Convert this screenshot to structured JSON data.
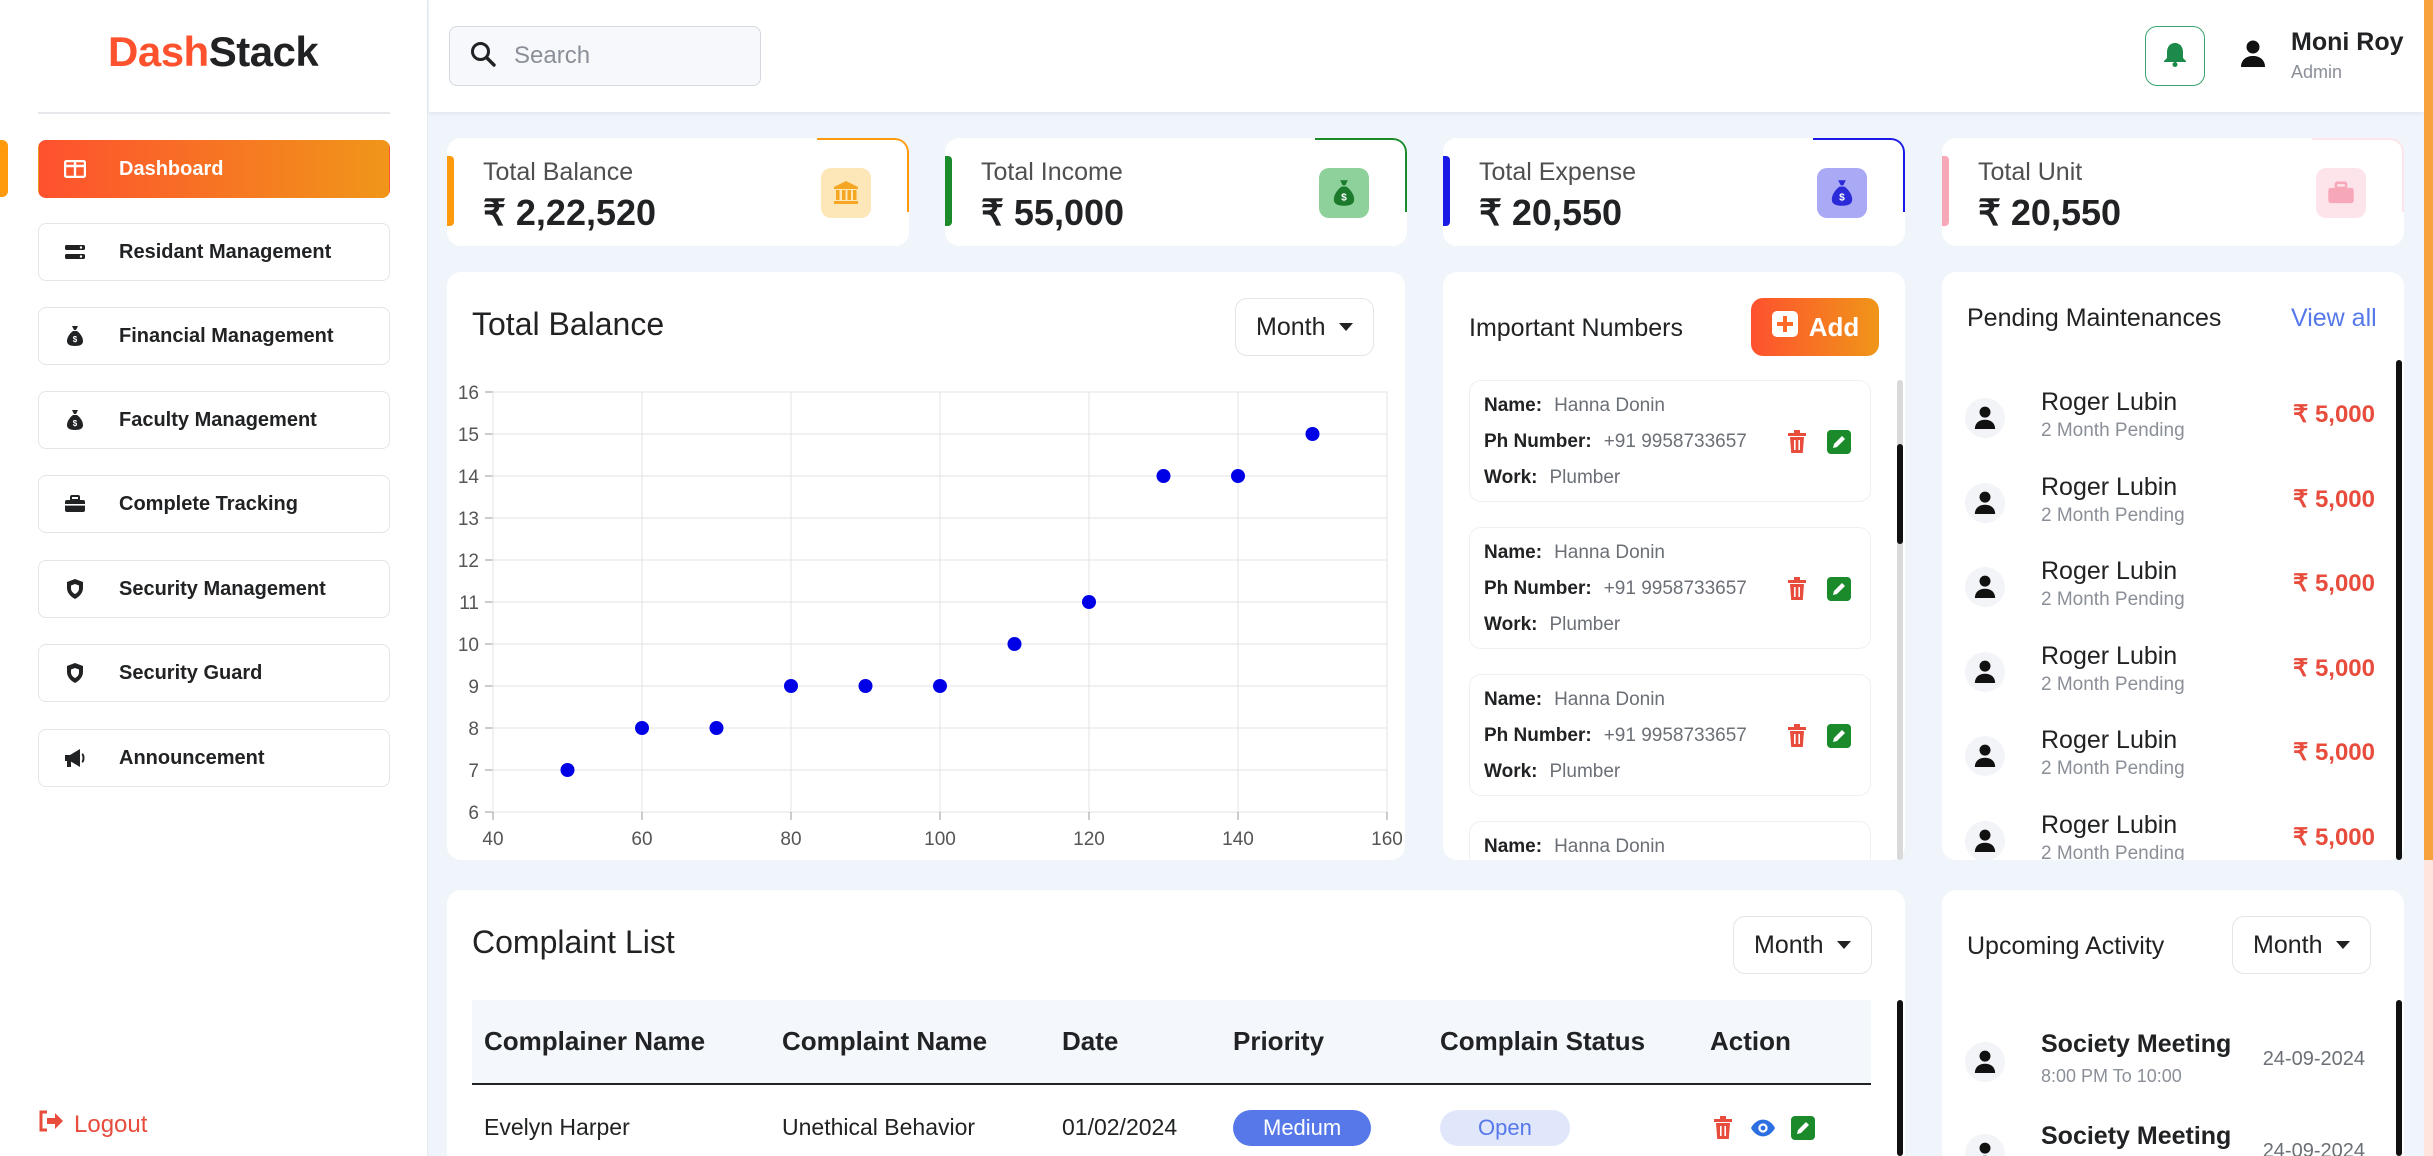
{
  "app": {
    "logo_part1": "Dash",
    "logo_part2": "Stack"
  },
  "sidebar": {
    "items": [
      {
        "label": "Dashboard",
        "icon": "dashboard-icon"
      },
      {
        "label": "Residant Management",
        "icon": "list-icon"
      },
      {
        "label": "Financial Management",
        "icon": "money-bag-icon"
      },
      {
        "label": "Faculty Management",
        "icon": "money-bag-icon"
      },
      {
        "label": "Complete Tracking",
        "icon": "briefcase-icon"
      },
      {
        "label": "Security Management",
        "icon": "shield-icon"
      },
      {
        "label": "Security Guard",
        "icon": "shield-icon"
      },
      {
        "label": "Announcement",
        "icon": "megaphone-icon"
      }
    ],
    "logout": "Logout"
  },
  "header": {
    "search_placeholder": "Search",
    "user_name": "Moni Roy",
    "user_role": "Admin"
  },
  "stats": [
    {
      "label": "Total Balance",
      "value": "₹ 2,22,520",
      "color": "#fe9a0c",
      "icon": "bank-icon"
    },
    {
      "label": "Total Income",
      "value": "₹ 55,000",
      "color": "#1b8a2b",
      "icon": "money-bag-icon"
    },
    {
      "label": "Total Expense",
      "value": "₹ 20,550",
      "color": "#1a1ae6",
      "icon": "money-bag-icon"
    },
    {
      "label": "Total Unit",
      "value": "₹ 20,550",
      "color": "#f7a8b8",
      "icon": "briefcase-icon"
    }
  ],
  "balance_chart": {
    "title": "Total Balance",
    "filter": "Month"
  },
  "chart_data": {
    "type": "scatter",
    "title": "",
    "xlabel": "",
    "ylabel": "",
    "xlim": [
      40,
      160
    ],
    "ylim": [
      6,
      16
    ],
    "xticks": [
      "40",
      "60",
      "80",
      "100",
      "120",
      "140",
      "160"
    ],
    "yticks": [
      "6",
      "7",
      "8",
      "9",
      "10",
      "11",
      "12",
      "13",
      "14",
      "15",
      "16"
    ],
    "grid": true,
    "series": [
      {
        "color": "#0000e6",
        "x": [
          50,
          60,
          70,
          80,
          90,
          100,
          110,
          120,
          130,
          140,
          150
        ],
        "y": [
          7,
          8,
          8,
          9,
          9,
          9,
          10,
          11,
          14,
          14,
          15
        ]
      }
    ]
  },
  "important_numbers": {
    "title": "Important Numbers",
    "add_label": "Add",
    "name_label": "Name:",
    "phone_label": "Ph Number:",
    "work_label": "Work:",
    "items": [
      {
        "name": "Hanna Donin",
        "phone": "+91 9958733657",
        "work": "Plumber"
      },
      {
        "name": "Hanna Donin",
        "phone": "+91 9958733657",
        "work": "Plumber"
      },
      {
        "name": "Hanna Donin",
        "phone": "+91 9958733657",
        "work": "Plumber"
      },
      {
        "name": "Hanna Donin"
      }
    ]
  },
  "pending": {
    "title": "Pending Maintenances",
    "view_all": "View all",
    "items": [
      {
        "name": "Roger Lubin",
        "sub": "2 Month Pending",
        "amount": "₹ 5,000"
      },
      {
        "name": "Roger Lubin",
        "sub": "2 Month Pending",
        "amount": "₹ 5,000"
      },
      {
        "name": "Roger Lubin",
        "sub": "2 Month Pending",
        "amount": "₹ 5,000"
      },
      {
        "name": "Roger Lubin",
        "sub": "2 Month Pending",
        "amount": "₹ 5,000"
      },
      {
        "name": "Roger Lubin",
        "sub": "2 Month Pending",
        "amount": "₹ 5,000"
      },
      {
        "name": "Roger Lubin",
        "sub": "2 Month Pending",
        "amount": "₹ 5,000"
      }
    ]
  },
  "complaints": {
    "title": "Complaint List",
    "filter": "Month",
    "columns": [
      "Complainer Name",
      "Complaint Name",
      "Date",
      "Priority",
      "Complain Status",
      "Action"
    ],
    "rows": [
      {
        "complainer": "Evelyn Harper",
        "complaint": "Unethical Behavior",
        "date": "01/02/2024",
        "priority": "Medium",
        "status": "Open"
      }
    ]
  },
  "upcoming": {
    "title": "Upcoming Activity",
    "filter": "Month",
    "items": [
      {
        "name": "Society Meeting",
        "time": "8:00 PM To 10:00",
        "date": "24-09-2024"
      },
      {
        "name": "Society Meeting",
        "time": "",
        "date": "24-09-2024"
      }
    ]
  }
}
